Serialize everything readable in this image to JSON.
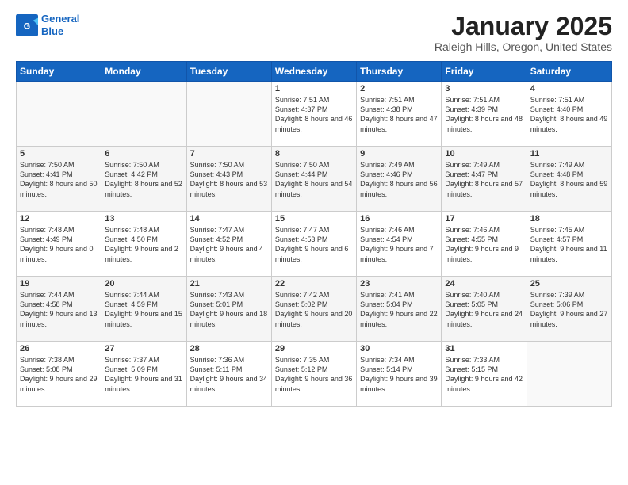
{
  "header": {
    "logo_line1": "General",
    "logo_line2": "Blue",
    "month_title": "January 2025",
    "location": "Raleigh Hills, Oregon, United States"
  },
  "days_of_week": [
    "Sunday",
    "Monday",
    "Tuesday",
    "Wednesday",
    "Thursday",
    "Friday",
    "Saturday"
  ],
  "weeks": [
    [
      {
        "day": "",
        "content": ""
      },
      {
        "day": "",
        "content": ""
      },
      {
        "day": "",
        "content": ""
      },
      {
        "day": "1",
        "content": "Sunrise: 7:51 AM\nSunset: 4:37 PM\nDaylight: 8 hours and 46 minutes."
      },
      {
        "day": "2",
        "content": "Sunrise: 7:51 AM\nSunset: 4:38 PM\nDaylight: 8 hours and 47 minutes."
      },
      {
        "day": "3",
        "content": "Sunrise: 7:51 AM\nSunset: 4:39 PM\nDaylight: 8 hours and 48 minutes."
      },
      {
        "day": "4",
        "content": "Sunrise: 7:51 AM\nSunset: 4:40 PM\nDaylight: 8 hours and 49 minutes."
      }
    ],
    [
      {
        "day": "5",
        "content": "Sunrise: 7:50 AM\nSunset: 4:41 PM\nDaylight: 8 hours and 50 minutes."
      },
      {
        "day": "6",
        "content": "Sunrise: 7:50 AM\nSunset: 4:42 PM\nDaylight: 8 hours and 52 minutes."
      },
      {
        "day": "7",
        "content": "Sunrise: 7:50 AM\nSunset: 4:43 PM\nDaylight: 8 hours and 53 minutes."
      },
      {
        "day": "8",
        "content": "Sunrise: 7:50 AM\nSunset: 4:44 PM\nDaylight: 8 hours and 54 minutes."
      },
      {
        "day": "9",
        "content": "Sunrise: 7:49 AM\nSunset: 4:46 PM\nDaylight: 8 hours and 56 minutes."
      },
      {
        "day": "10",
        "content": "Sunrise: 7:49 AM\nSunset: 4:47 PM\nDaylight: 8 hours and 57 minutes."
      },
      {
        "day": "11",
        "content": "Sunrise: 7:49 AM\nSunset: 4:48 PM\nDaylight: 8 hours and 59 minutes."
      }
    ],
    [
      {
        "day": "12",
        "content": "Sunrise: 7:48 AM\nSunset: 4:49 PM\nDaylight: 9 hours and 0 minutes."
      },
      {
        "day": "13",
        "content": "Sunrise: 7:48 AM\nSunset: 4:50 PM\nDaylight: 9 hours and 2 minutes."
      },
      {
        "day": "14",
        "content": "Sunrise: 7:47 AM\nSunset: 4:52 PM\nDaylight: 9 hours and 4 minutes."
      },
      {
        "day": "15",
        "content": "Sunrise: 7:47 AM\nSunset: 4:53 PM\nDaylight: 9 hours and 6 minutes."
      },
      {
        "day": "16",
        "content": "Sunrise: 7:46 AM\nSunset: 4:54 PM\nDaylight: 9 hours and 7 minutes."
      },
      {
        "day": "17",
        "content": "Sunrise: 7:46 AM\nSunset: 4:55 PM\nDaylight: 9 hours and 9 minutes."
      },
      {
        "day": "18",
        "content": "Sunrise: 7:45 AM\nSunset: 4:57 PM\nDaylight: 9 hours and 11 minutes."
      }
    ],
    [
      {
        "day": "19",
        "content": "Sunrise: 7:44 AM\nSunset: 4:58 PM\nDaylight: 9 hours and 13 minutes."
      },
      {
        "day": "20",
        "content": "Sunrise: 7:44 AM\nSunset: 4:59 PM\nDaylight: 9 hours and 15 minutes."
      },
      {
        "day": "21",
        "content": "Sunrise: 7:43 AM\nSunset: 5:01 PM\nDaylight: 9 hours and 18 minutes."
      },
      {
        "day": "22",
        "content": "Sunrise: 7:42 AM\nSunset: 5:02 PM\nDaylight: 9 hours and 20 minutes."
      },
      {
        "day": "23",
        "content": "Sunrise: 7:41 AM\nSunset: 5:04 PM\nDaylight: 9 hours and 22 minutes."
      },
      {
        "day": "24",
        "content": "Sunrise: 7:40 AM\nSunset: 5:05 PM\nDaylight: 9 hours and 24 minutes."
      },
      {
        "day": "25",
        "content": "Sunrise: 7:39 AM\nSunset: 5:06 PM\nDaylight: 9 hours and 27 minutes."
      }
    ],
    [
      {
        "day": "26",
        "content": "Sunrise: 7:38 AM\nSunset: 5:08 PM\nDaylight: 9 hours and 29 minutes."
      },
      {
        "day": "27",
        "content": "Sunrise: 7:37 AM\nSunset: 5:09 PM\nDaylight: 9 hours and 31 minutes."
      },
      {
        "day": "28",
        "content": "Sunrise: 7:36 AM\nSunset: 5:11 PM\nDaylight: 9 hours and 34 minutes."
      },
      {
        "day": "29",
        "content": "Sunrise: 7:35 AM\nSunset: 5:12 PM\nDaylight: 9 hours and 36 minutes."
      },
      {
        "day": "30",
        "content": "Sunrise: 7:34 AM\nSunset: 5:14 PM\nDaylight: 9 hours and 39 minutes."
      },
      {
        "day": "31",
        "content": "Sunrise: 7:33 AM\nSunset: 5:15 PM\nDaylight: 9 hours and 42 minutes."
      },
      {
        "day": "",
        "content": ""
      }
    ]
  ]
}
